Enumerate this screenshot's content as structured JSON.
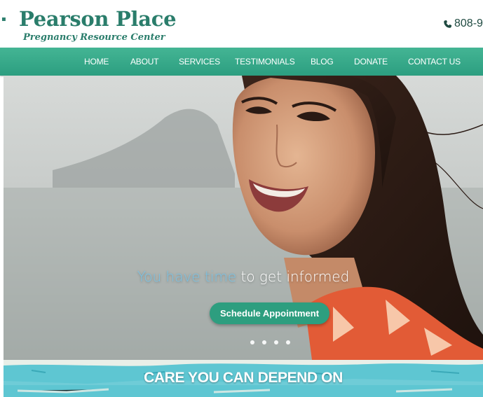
{
  "header": {
    "brand_title": "Pearson Place",
    "brand_subtitle": "Pregnancy Resource Center",
    "phone": "808-9"
  },
  "nav": {
    "items": [
      {
        "label": "HOME"
      },
      {
        "label": "ABOUT"
      },
      {
        "label": "SERVICES"
      },
      {
        "label": "TESTIMONIALS"
      },
      {
        "label": "BLOG"
      },
      {
        "label": "DONATE"
      },
      {
        "label": "CONTACT US"
      }
    ]
  },
  "hero": {
    "tagline_highlight": "You have time",
    "tagline_rest": " to get informed",
    "cta_label": "Schedule Appointment",
    "slide_count": 4
  },
  "banner": {
    "text": "CARE YOU CAN DEPEND ON"
  },
  "colors": {
    "brand_green": "#2a7d6b",
    "nav_green": "#3aae8c",
    "highlight_blue": "#7cc4e6",
    "banner_teal": "#5ec6d2"
  }
}
